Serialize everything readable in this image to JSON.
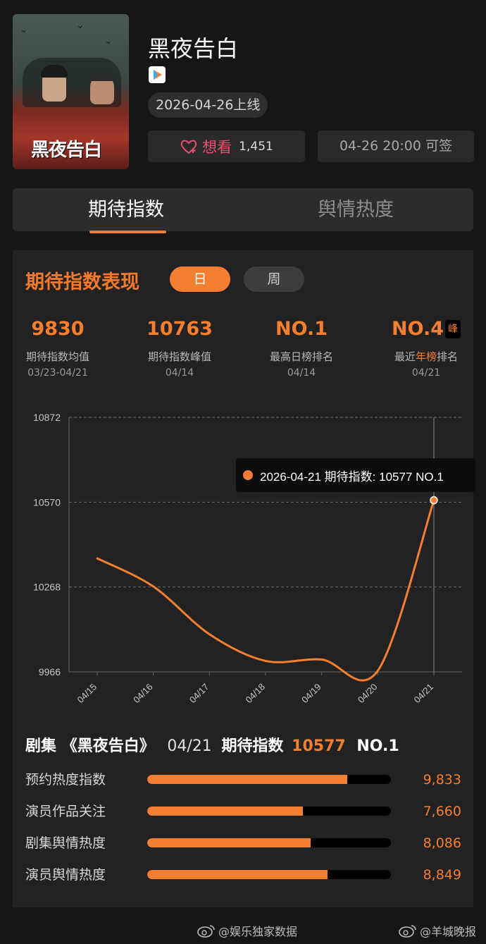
{
  "poster": {
    "title_art": "黑夜告白"
  },
  "header": {
    "title": "黑夜告白",
    "release": "2026-04-26上线",
    "want_label": "想看",
    "want_count": "1,451",
    "sign_label": "04-26 20:00 可签"
  },
  "tabs": [
    {
      "label": "期待指数",
      "active": true
    },
    {
      "label": "舆情热度",
      "active": false
    }
  ],
  "section": {
    "title": "期待指数表现",
    "toggle_day": "日",
    "toggle_week": "周"
  },
  "stats": [
    {
      "value": "9830",
      "label": "期待指数均值",
      "date": "03/23-04/21"
    },
    {
      "value": "10763",
      "label": "期待指数峰值",
      "date": "04/14"
    },
    {
      "value": "NO.1",
      "label": "最高日榜排名",
      "date": "04/14"
    },
    {
      "value": "NO.4",
      "badge": "峰",
      "label_pre": "最近",
      "label_hl": "年榜",
      "label_post": "排名",
      "date": "04/21"
    }
  ],
  "chart_data": {
    "type": "line",
    "x": [
      "04/15",
      "04/16",
      "04/17",
      "04/18",
      "04/19",
      "04/20",
      "04/21"
    ],
    "series": [
      {
        "values": [
          10370,
          10270,
          10100,
          10005,
          10010,
          9970,
          10577
        ]
      }
    ],
    "yticks": [
      "10872",
      "10570",
      "10268",
      "9966"
    ],
    "ylim": [
      9966,
      10872
    ],
    "grid": true,
    "color": "#f47f30",
    "tooltip": "2026-04-21 期待指数: 10577 NO.1"
  },
  "detail": {
    "category": "剧集",
    "show": "《黑夜告白》",
    "date": "04/21",
    "index_label": "期待指数",
    "index_value": "10577",
    "rank": "NO.1",
    "metrics": [
      {
        "label": "预约热度指数",
        "value": "9,833",
        "level": 0.82
      },
      {
        "label": "演员作品关注",
        "value": "7,660",
        "level": 0.64
      },
      {
        "label": "剧集舆情热度",
        "value": "8,086",
        "level": 0.67
      },
      {
        "label": "演员舆情热度",
        "value": "8,849",
        "level": 0.74
      }
    ]
  },
  "watermarks": [
    "@娱乐独家数据",
    "@羊城晚报"
  ],
  "colors": {
    "accent": "#f47f30",
    "want": "#ef4f6f",
    "background": "#161616",
    "panel": "#222222"
  }
}
